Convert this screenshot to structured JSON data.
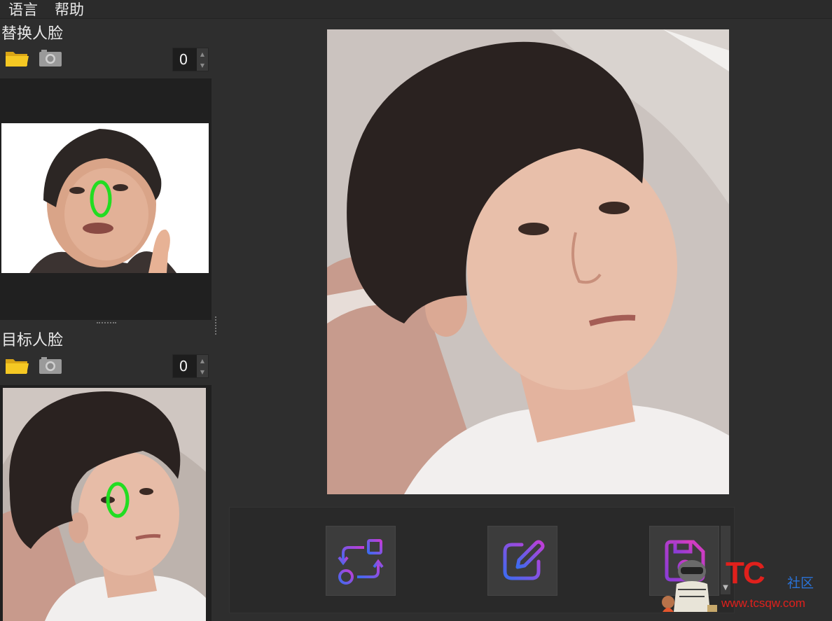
{
  "menu": {
    "language": "语言",
    "help": "帮助"
  },
  "swap_face": {
    "label": "替换人脸",
    "count": "0",
    "marker": "0"
  },
  "target_face": {
    "label": "目标人脸",
    "count": "0",
    "marker": "0"
  },
  "actions": {
    "swap": "swap-icon",
    "edit": "edit-icon",
    "save": "save-icon"
  },
  "watermark": {
    "brand": "TC",
    "cn": "社区",
    "url": "www.tcsqw.com"
  },
  "colors": {
    "background": "#2e2e2e",
    "panel": "#202020",
    "folder": "#f2c21c",
    "marker": "#22dd22",
    "gradient_start": "#3b6cf0",
    "gradient_end": "#c43cd6",
    "watermark_red": "#e0201c"
  }
}
